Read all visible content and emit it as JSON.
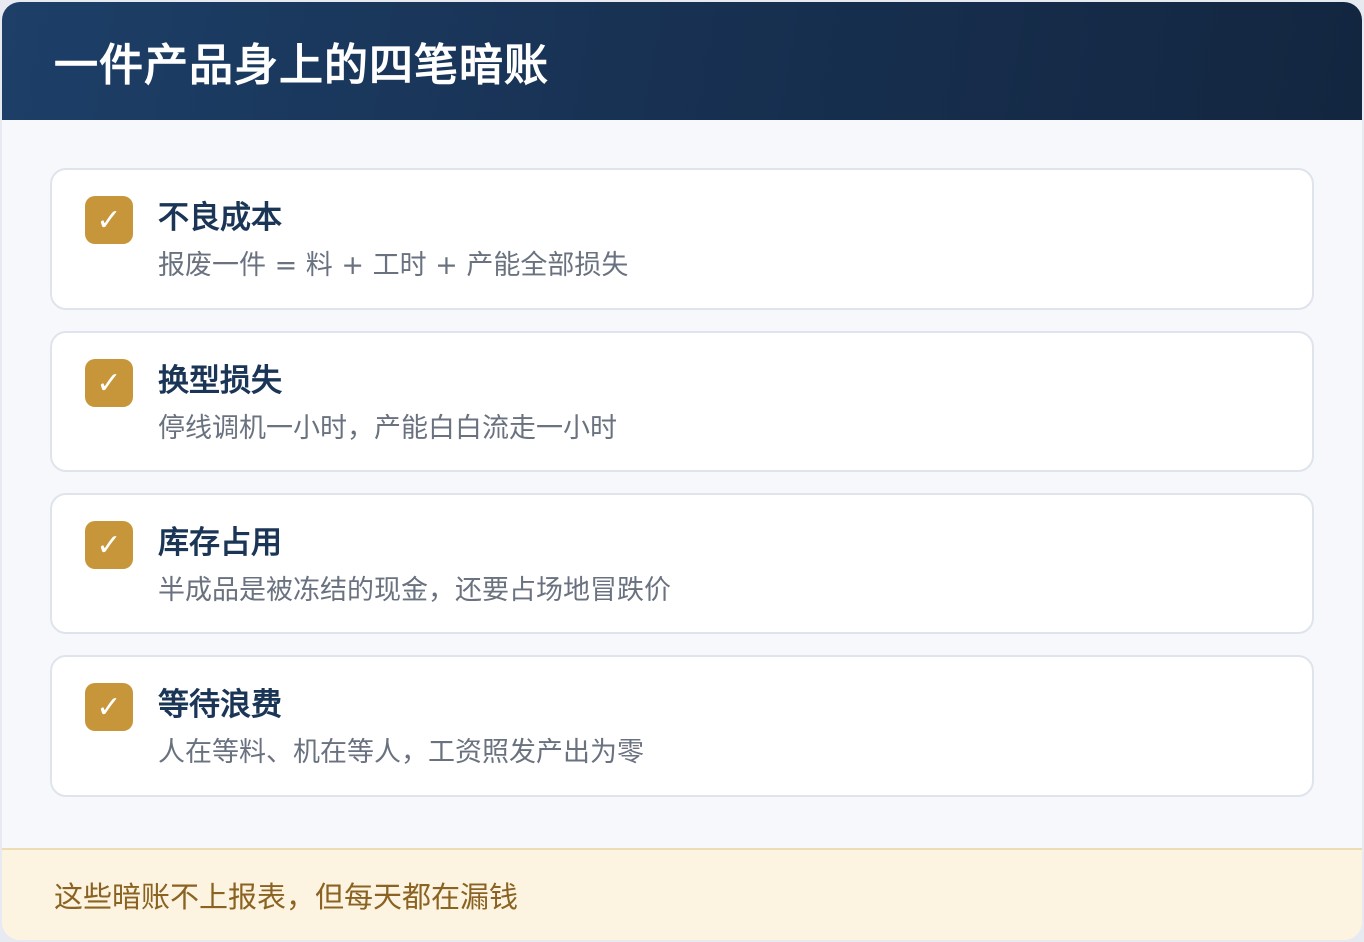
{
  "header": {
    "title": "一件产品身上的四笔暗账"
  },
  "items": [
    {
      "icon": "checkmark",
      "check": "✓",
      "title": "不良成本",
      "description": "报废一件 = 料 + 工时 + 产能全部损失"
    },
    {
      "icon": "checkmark",
      "check": "✓",
      "title": "换型损失",
      "description": "停线调机一小时，产能白白流走一小时"
    },
    {
      "icon": "checkmark",
      "check": "✓",
      "title": "库存占用",
      "description": "半成品是被冻结的现金，还要占场地冒跌价"
    },
    {
      "icon": "checkmark",
      "check": "✓",
      "title": "等待浪费",
      "description": "人在等料、机在等人，工资照发产出为零"
    }
  ],
  "footer": {
    "text": "这些暗账不上报表，但每天都在漏钱"
  },
  "colors": {
    "header_bg": "#1a3558",
    "accent": "#c8963a",
    "title_text": "#1b3556",
    "footer_bg": "#fdf3e1",
    "footer_text": "#8a6322"
  }
}
